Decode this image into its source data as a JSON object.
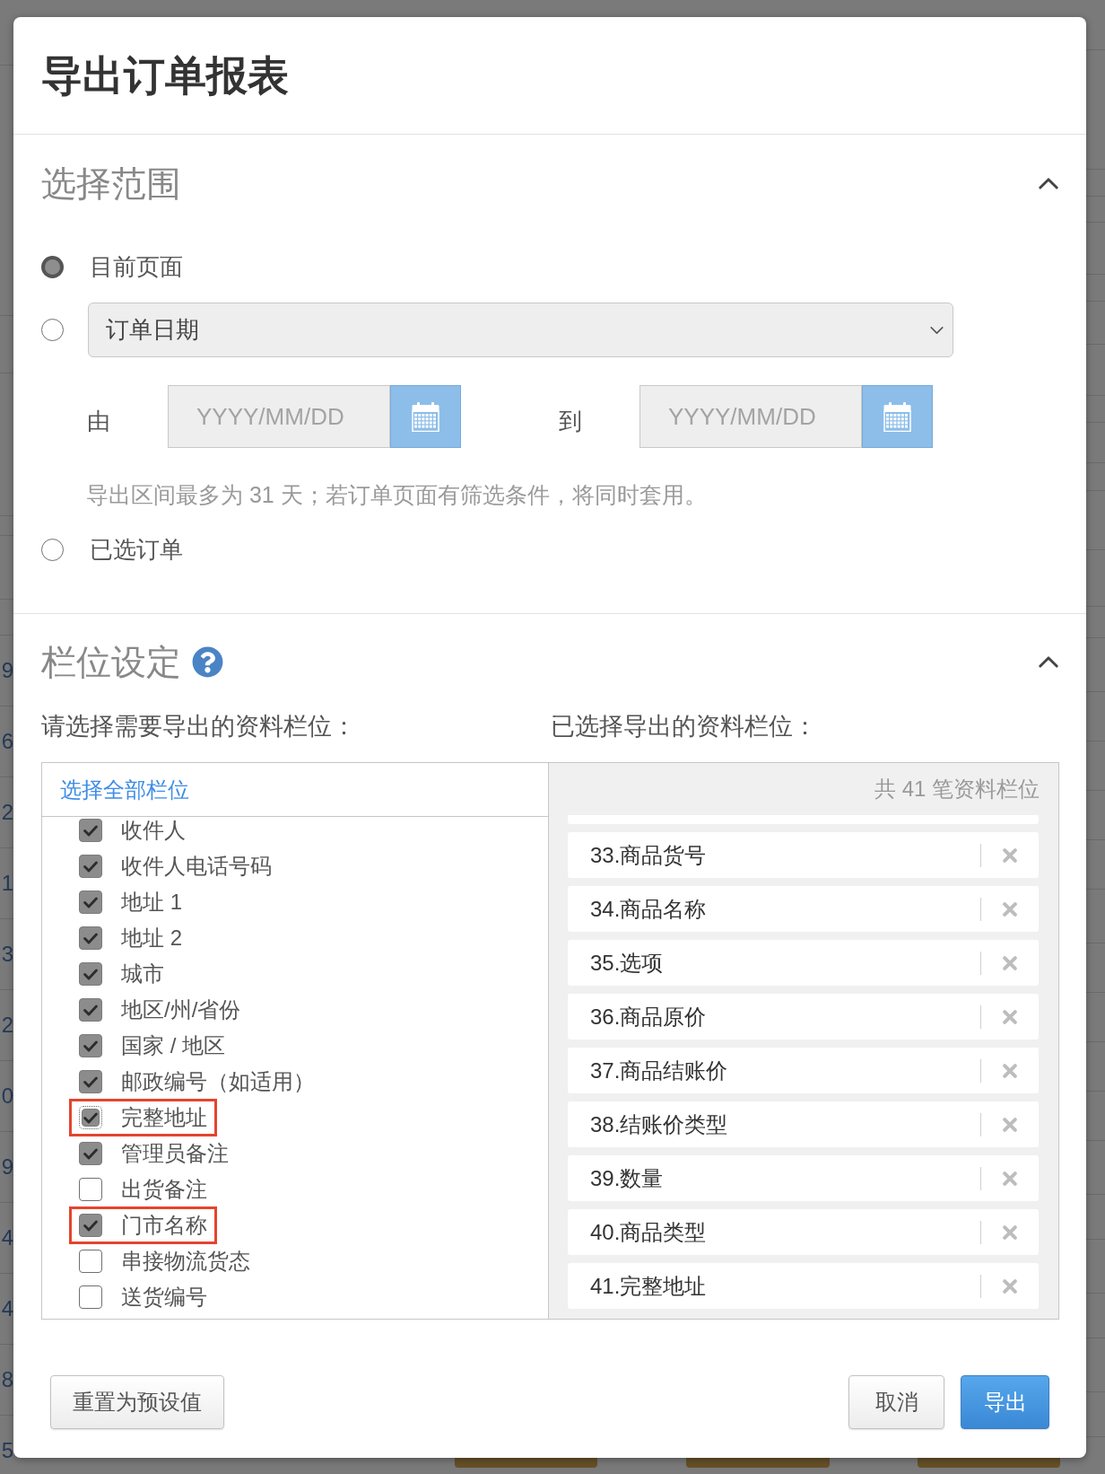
{
  "background_page": {
    "left_edge_fragments": [
      "9",
      "6",
      "2",
      "1",
      "3",
      "2",
      "0",
      "9",
      "4",
      "4",
      "8",
      "5"
    ]
  },
  "dialog": {
    "title": "导出订单报表"
  },
  "range_section": {
    "title": "选择范围",
    "expanded": true,
    "options": [
      {
        "kind": "plain",
        "label": "目前页面",
        "selected": true
      },
      {
        "kind": "date_range",
        "selected": false,
        "select": {
          "value": "订单日期"
        },
        "from": {
          "label": "由",
          "placeholder": "YYYY/MM/DD"
        },
        "to": {
          "label": "到",
          "placeholder": "YYYY/MM/DD"
        },
        "hint": "导出区间最多为 31 天；若订单页面有筛选条件，将同时套用。"
      },
      {
        "kind": "plain",
        "label": "已选订单",
        "selected": false
      }
    ]
  },
  "fields_section": {
    "title": "栏位设定",
    "expanded": true,
    "available": {
      "label": "请选择需要导出的资料栏位：",
      "select_all": "选择全部栏位",
      "items": [
        {
          "label": "收件人",
          "checked": true,
          "focused": false,
          "highlighted": false
        },
        {
          "label": "收件人电话号码",
          "checked": true,
          "focused": false,
          "highlighted": false
        },
        {
          "label": "地址 1",
          "checked": true,
          "focused": false,
          "highlighted": false
        },
        {
          "label": "地址 2",
          "checked": true,
          "focused": false,
          "highlighted": false
        },
        {
          "label": "城市",
          "checked": true,
          "focused": false,
          "highlighted": false
        },
        {
          "label": "地区/州/省份",
          "checked": true,
          "focused": false,
          "highlighted": false
        },
        {
          "label": "国家 / 地区",
          "checked": true,
          "focused": false,
          "highlighted": false
        },
        {
          "label": "邮政编号（如适用）",
          "checked": true,
          "focused": false,
          "highlighted": false
        },
        {
          "label": "完整地址",
          "checked": true,
          "focused": true,
          "highlighted": true
        },
        {
          "label": "管理员备注",
          "checked": true,
          "focused": false,
          "highlighted": false
        },
        {
          "label": "出货备注",
          "checked": false,
          "focused": false,
          "highlighted": false
        },
        {
          "label": "门市名称",
          "checked": true,
          "focused": false,
          "highlighted": true
        },
        {
          "label": "串接物流货态",
          "checked": false,
          "focused": false,
          "highlighted": false
        },
        {
          "label": "送货编号",
          "checked": false,
          "focused": false,
          "highlighted": false
        }
      ]
    },
    "selected": {
      "label": "已选择导出的资料栏位：",
      "count": "共 41 笔资料栏位",
      "items": [
        "33.商品货号",
        "34.商品名称",
        "35.选项",
        "36.商品原价",
        "37.商品结账价",
        "38.结账价类型",
        "39.数量",
        "40.商品类型",
        "41.完整地址"
      ]
    }
  },
  "footer": {
    "buttons": [
      {
        "kind": "reset",
        "label": "重置为预设值"
      },
      {
        "kind": "cancel",
        "label": "取消"
      },
      {
        "kind": "primary",
        "label": "导出"
      }
    ]
  }
}
